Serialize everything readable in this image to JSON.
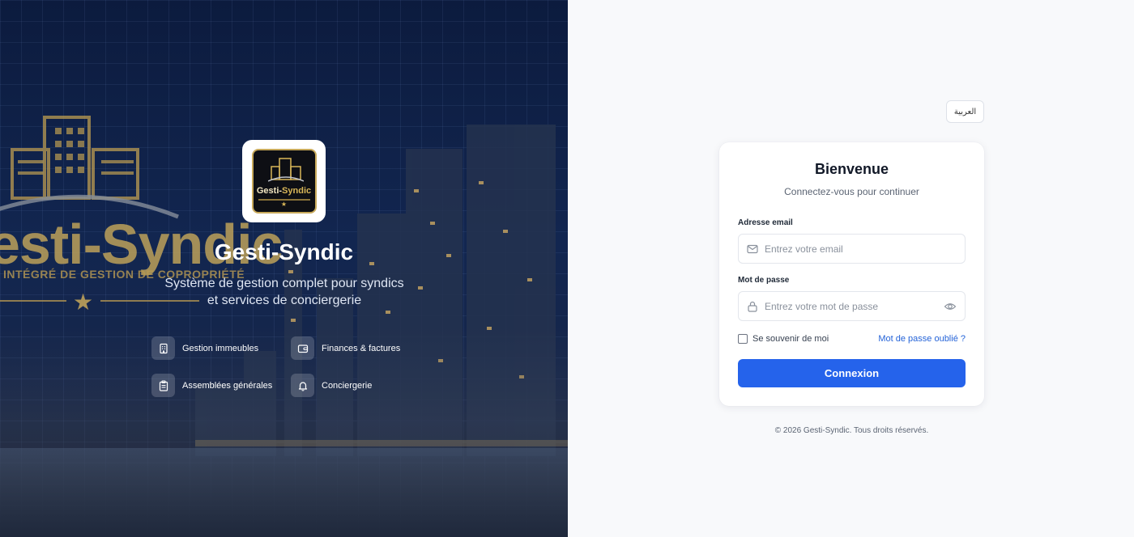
{
  "hero": {
    "bg_logo_text": "esti-Syndic",
    "bg_logo_tagline": "INTÉGRÉ DE GESTION DE COPROPRIÉTÉ",
    "logo_name_part1": "Gesti-",
    "logo_name_part2": "Syndic",
    "title": "Gesti-Syndic",
    "subtitle": "Système de gestion complet pour syndics et services de conciergerie",
    "features": [
      {
        "label": "Gestion immeubles",
        "icon": "building-icon"
      },
      {
        "label": "Finances & factures",
        "icon": "wallet-icon"
      },
      {
        "label": "Assemblées générales",
        "icon": "clipboard-icon"
      },
      {
        "label": "Conciergerie",
        "icon": "bell-icon"
      }
    ]
  },
  "language_button": "العربية",
  "login": {
    "title": "Bienvenue",
    "subtitle": "Connectez-vous pour continuer",
    "email_label": "Adresse email",
    "email_placeholder": "Entrez votre email",
    "email_value": "",
    "password_label": "Mot de passe",
    "password_placeholder": "Entrez votre mot de passe",
    "password_value": "",
    "remember_label": "Se souvenir de moi",
    "remember_checked": false,
    "forgot_label": "Mot de passe oublié ?",
    "submit_label": "Connexion"
  },
  "footer": "© 2026 Gesti-Syndic. Tous droits réservés.",
  "colors": {
    "accent": "#2563eb",
    "link": "#2463d8",
    "hero_bg": "#122650",
    "gold": "#c8a95a"
  }
}
